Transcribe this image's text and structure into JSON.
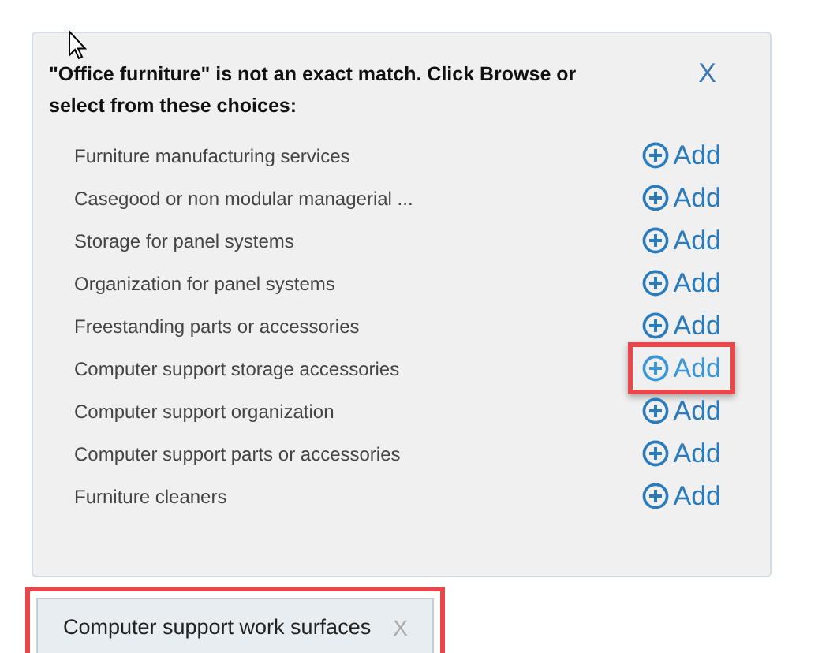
{
  "panel": {
    "message": "\"Office furniture\" is not an exact match. Click Browse or select from these choices:",
    "close": "X"
  },
  "choices": [
    {
      "label": "Furniture manufacturing services",
      "action": "Add",
      "highlighted": false
    },
    {
      "label": "Casegood or non modular managerial ...",
      "action": "Add",
      "highlighted": false
    },
    {
      "label": "Storage for panel systems",
      "action": "Add",
      "highlighted": false
    },
    {
      "label": "Organization for panel systems",
      "action": "Add",
      "highlighted": false
    },
    {
      "label": "Freestanding parts or accessories",
      "action": "Add",
      "highlighted": false
    },
    {
      "label": "Computer support storage accessories",
      "action": "Add",
      "highlighted": true
    },
    {
      "label": "Computer support organization",
      "action": "Add",
      "highlighted": false
    },
    {
      "label": "Computer support parts or accessories",
      "action": "Add",
      "highlighted": false
    },
    {
      "label": "Furniture cleaners",
      "action": "Add",
      "highlighted": false
    }
  ],
  "selected_tags": [
    {
      "label": "Computer support work surfaces",
      "remove": "X",
      "highlighted": true
    }
  ]
}
